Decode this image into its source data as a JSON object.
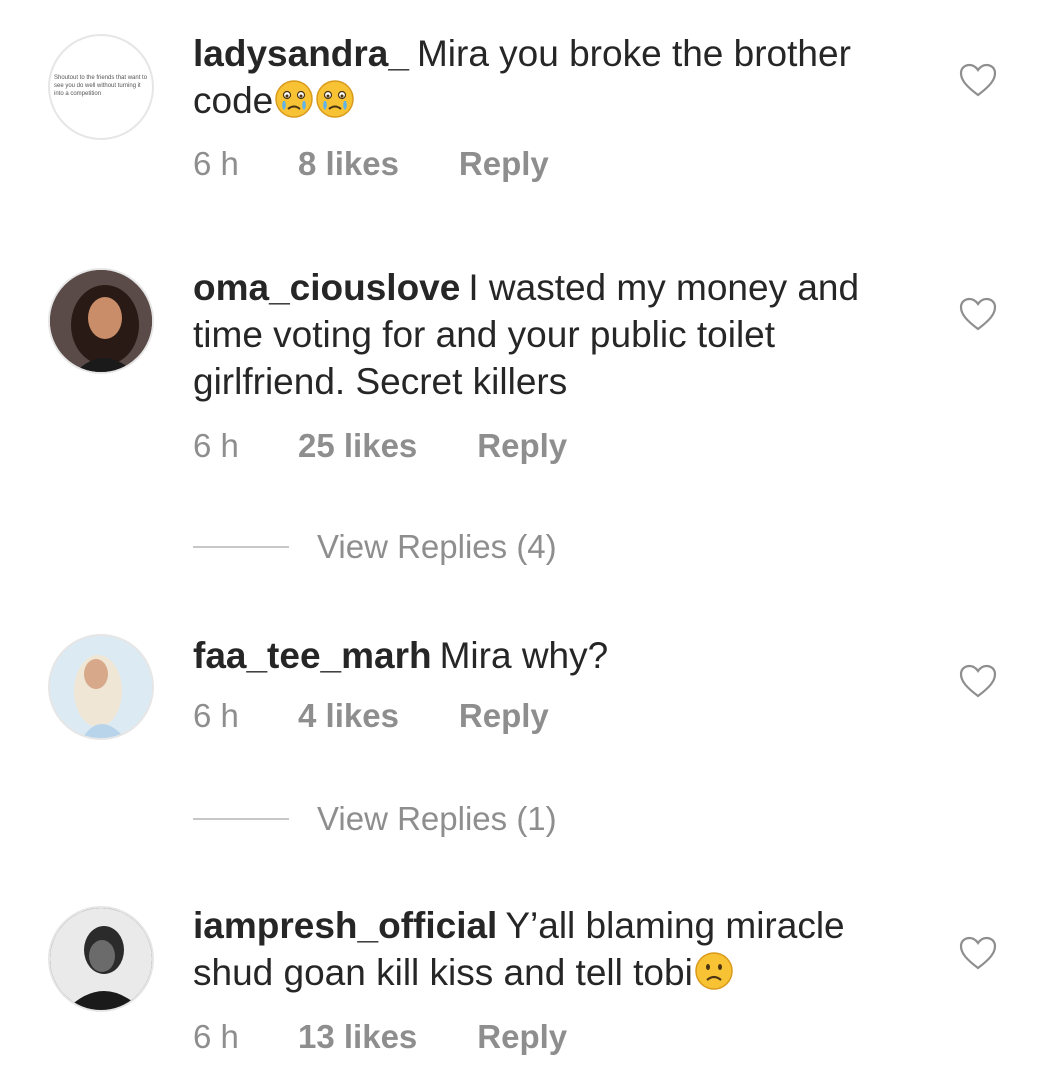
{
  "comments": [
    {
      "username": "ladysandra_",
      "text": "Mira you broke the brother code",
      "emoji": "crying-face",
      "avatar_text": "Shoutout to the friends that want to see you do well without turning it into a competition",
      "time": "6 h",
      "likes": "8 likes",
      "reply": "Reply"
    },
    {
      "username": "oma_ciouslove",
      "text": "I wasted my money and time voting for and your public toilet girlfriend. Secret killers",
      "time": "6 h",
      "likes": "25 likes",
      "reply": "Reply",
      "view_replies": "View Replies (4)"
    },
    {
      "username": "faa_tee_marh",
      "text": "Mira why?",
      "time": "6 h",
      "likes": "4 likes",
      "reply": "Reply",
      "view_replies": "View Replies (1)"
    },
    {
      "username": "iampresh_official",
      "text": "Y’all blaming miracle shud goan kill kiss and tell tobi",
      "emoji": "frowning-face",
      "time": "6 h",
      "likes": "13 likes",
      "reply": "Reply"
    }
  ],
  "colors": {
    "text": "#262626",
    "meta": "#8e8e8e",
    "divider": "#c7c7c7",
    "emoji": "#f7c234"
  },
  "icons": [
    "heart-icon",
    "crying-face-emoji",
    "frowning-face-emoji"
  ]
}
